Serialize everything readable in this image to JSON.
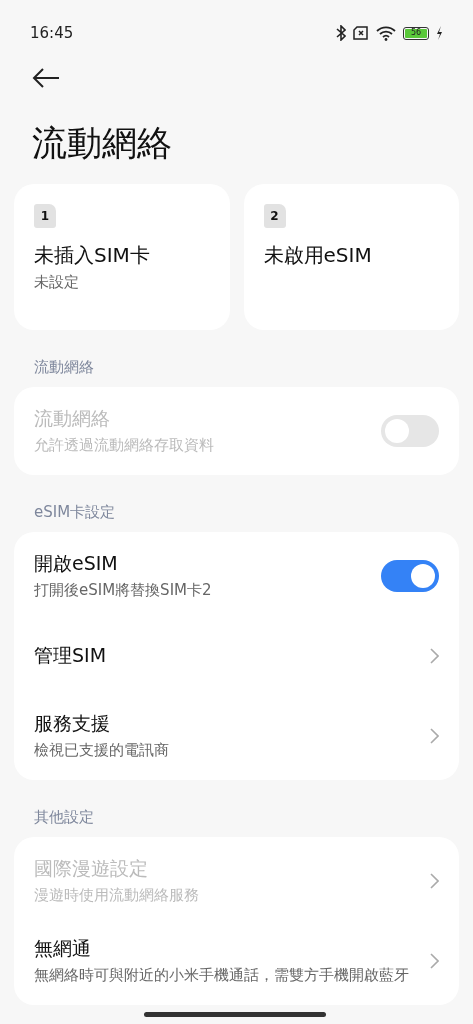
{
  "status_bar": {
    "time": "16:45",
    "battery": "56"
  },
  "title": "流動網絡",
  "sim_cards": [
    {
      "slot": "1",
      "name": "未插入SIM卡",
      "status": "未設定"
    },
    {
      "slot": "2",
      "name": "未啟用eSIM"
    }
  ],
  "sections": [
    {
      "header": "流動網絡",
      "items": [
        {
          "kind": "toggle",
          "title": "流動網絡",
          "subtitle": "允許透過流動網絡存取資料",
          "disabled": true,
          "on": false
        }
      ]
    },
    {
      "header": "eSIM卡設定",
      "items": [
        {
          "kind": "toggle",
          "title": "開啟eSIM",
          "subtitle": "打開後eSIM將替換SIM卡2",
          "disabled": false,
          "on": true
        },
        {
          "kind": "link",
          "title": "管理SIM",
          "disabled": false
        },
        {
          "kind": "link",
          "title": "服務支援",
          "subtitle": "檢視已支援的電訊商",
          "disabled": false
        }
      ]
    },
    {
      "header": "其他設定",
      "items": [
        {
          "kind": "link",
          "title": "國際漫遊設定",
          "subtitle": "漫遊時使用流動網絡服務",
          "disabled": true
        },
        {
          "kind": "link",
          "title": "無網通",
          "subtitle": "無網絡時可與附近的小米手機通話，需雙方手機開啟藍牙",
          "disabled": false
        }
      ]
    }
  ]
}
